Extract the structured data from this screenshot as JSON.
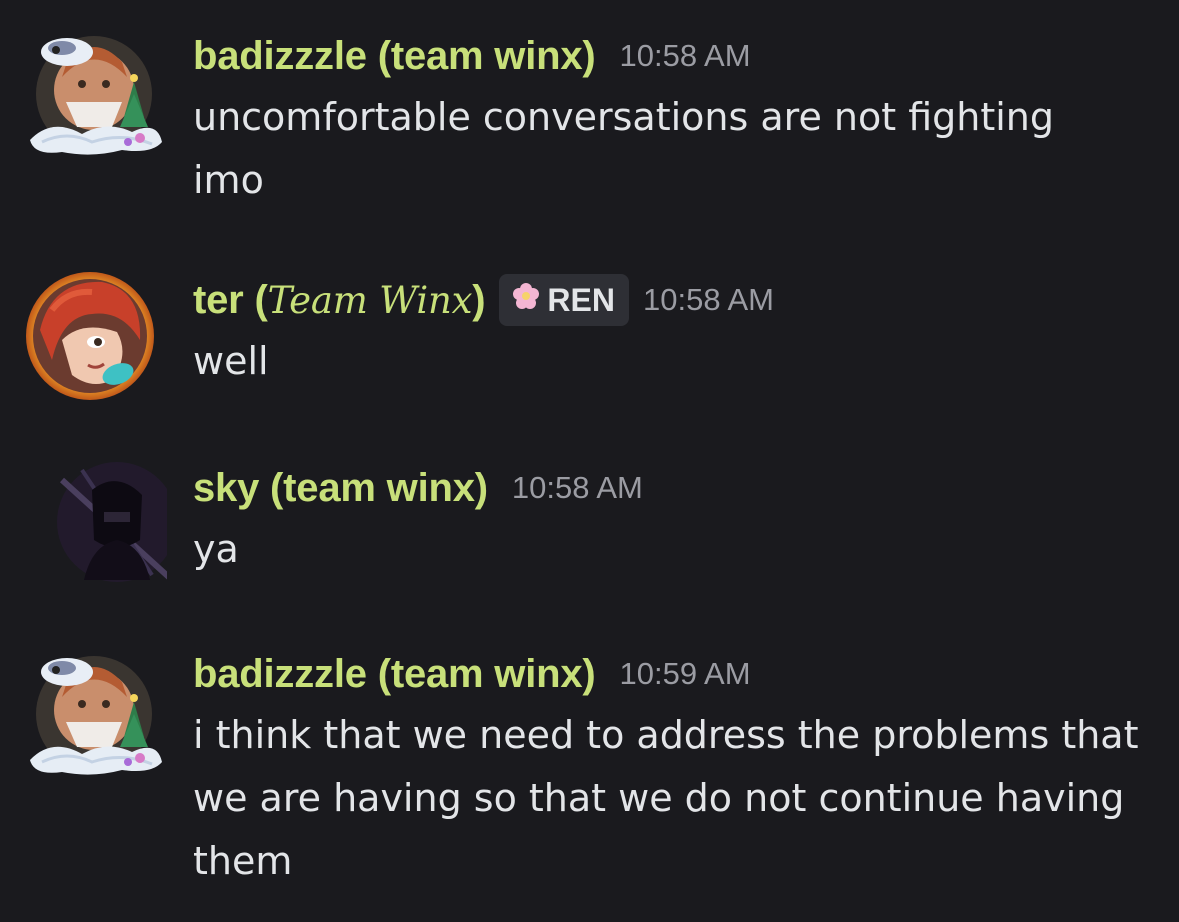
{
  "messages": [
    {
      "username": "badizzzle (team winx)",
      "timestamp": "10:58 AM",
      "text": "uncomfortable conversations are not fighting imo",
      "avatar_icon": "snow-globe-avatar-icon"
    },
    {
      "username_prefix": "ter (",
      "username_fancy": "Team Winx",
      "username_suffix": ")",
      "tag": "REN",
      "tag_icon": "pink-flower-icon",
      "timestamp": "10:58 AM",
      "text": "well",
      "avatar_icon": "red-hair-avatar-icon"
    },
    {
      "username": "sky (team winx)",
      "timestamp": "10:58 AM",
      "text": "ya",
      "avatar_icon": "dark-figure-avatar-icon"
    },
    {
      "username": "badizzzle (team winx)",
      "timestamp": "10:59 AM",
      "text": "i think that we need to address the problems that we are having so that we do not continue having them",
      "avatar_icon": "snow-globe-avatar-icon"
    }
  ],
  "colors": {
    "background": "#1a1a1e",
    "username": "#c8e07a",
    "timestamp": "#9b9ca3",
    "text": "#e3e5e8",
    "tag_bg": "#2e2f35"
  }
}
